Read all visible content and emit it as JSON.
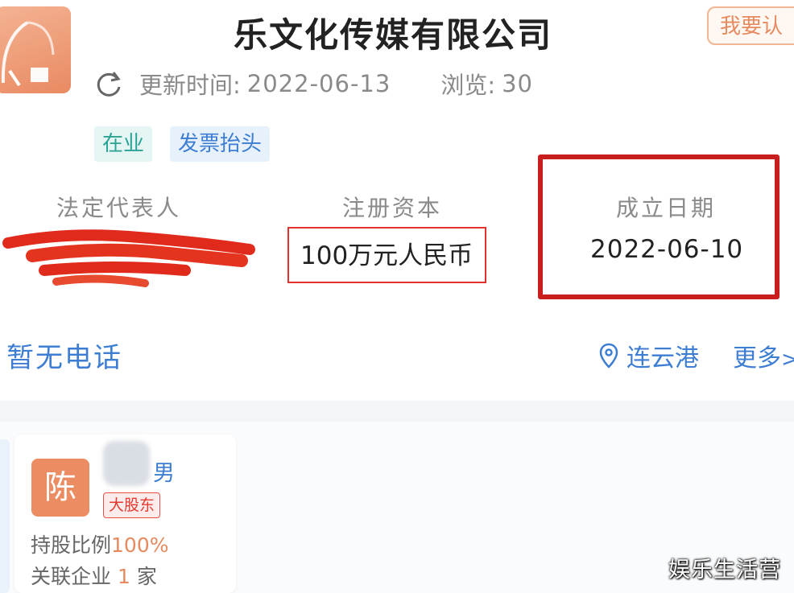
{
  "header": {
    "company_name": "乐文化传媒有限公司",
    "claim_button": "我要认",
    "updated_label": "更新时间:",
    "updated_value": "2022-06-13",
    "views_label": "浏览:",
    "views_value": "30"
  },
  "tags": {
    "status": "在业",
    "invoice": "发票抬头"
  },
  "stats": {
    "legal_rep_label": "法定代表人",
    "capital_label": "注册资本",
    "capital_value": "100万元人民币",
    "founded_label": "成立日期",
    "founded_value": "2022-06-10"
  },
  "contact": {
    "phone": "暂无电话",
    "location": "连云港",
    "more": "更多",
    "more_arrow": ">"
  },
  "shareholder": {
    "avatar_char": "陈",
    "gender": "男",
    "badge": "大股东",
    "share_label": "持股比例",
    "share_value": "100%",
    "related_label": "关联企业",
    "related_value": "1",
    "related_unit": "家"
  },
  "watermark": "娱乐生活营",
  "colors": {
    "accent_orange": "#ec8c62",
    "link_blue": "#3d7dd2",
    "status_teal": "#2aa395",
    "highlight_red": "#c81e1e"
  }
}
